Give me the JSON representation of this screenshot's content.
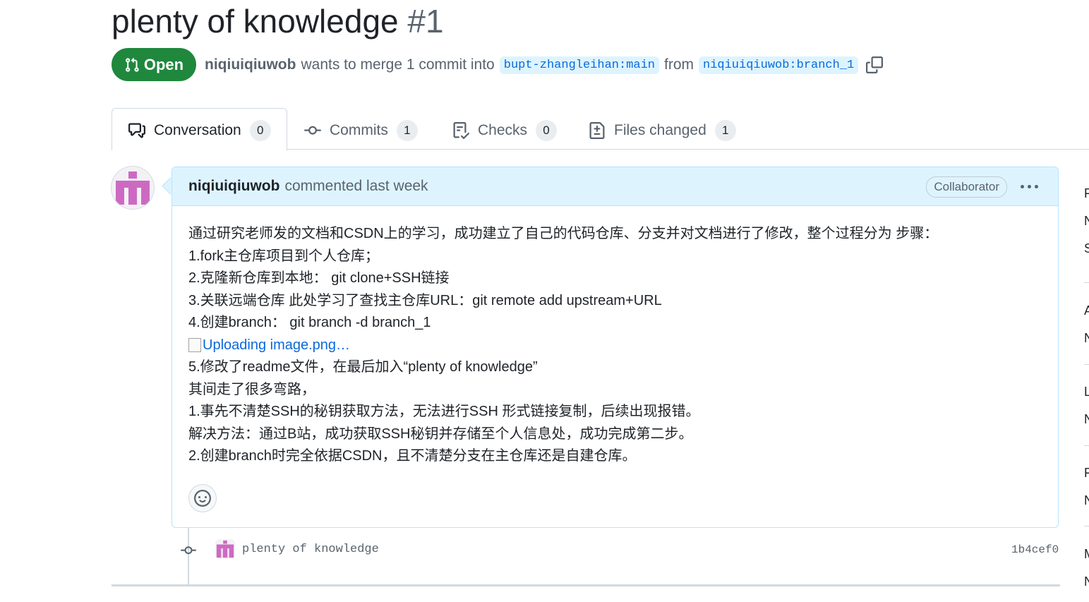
{
  "pr": {
    "title": "plenty of knowledge",
    "number": "#1",
    "state": "Open",
    "author": "niqiuiqiuwob",
    "merge_text": "wants to merge 1 commit into",
    "base_branch": "bupt-zhangleihan:main",
    "from_text": "from",
    "head_branch": "niqiuiqiuwob:branch_1"
  },
  "tabs": [
    {
      "label": "Conversation",
      "count": "0",
      "icon": "comment-discussion-icon"
    },
    {
      "label": "Commits",
      "count": "1",
      "icon": "commit-icon"
    },
    {
      "label": "Checks",
      "count": "0",
      "icon": "checklist-icon"
    },
    {
      "label": "Files changed",
      "count": "1",
      "icon": "file-diff-icon"
    }
  ],
  "comment": {
    "author": "niqiuiqiuwob",
    "meta": "commented last week",
    "badge": "Collaborator",
    "lines": [
      "通过研究老师发的文档和CSDN上的学习，成功建立了自己的代码仓库、分支并对文档进行了修改，整个过程分为 步骤：",
      "1.fork主仓库项目到个人仓库；",
      "2.克隆新仓库到本地： git clone+SSH链接",
      "3.关联远端仓库 此处学习了查找主仓库URL：git remote add upstream+URL",
      "4.创建branch： git branch -d branch_1",
      "Uploading image.png…",
      "5.修改了readme文件，在最后加入“plenty of knowledge”",
      "其间走了很多弯路，",
      "1.事先不清楚SSH的秘钥获取方法，无法进行SSH 形式链接复制，后续出现报错。",
      "解决方法：通过B站，成功获取SSH秘钥并存储至个人信息处，成功完成第二步。",
      "2.创建branch时完全依据CSDN，且不清楚分支在主仓库还是自建仓库。"
    ]
  },
  "commit": {
    "message": "plenty of knowledge",
    "sha": "1b4cef0"
  },
  "sidebar_letters": [
    "F",
    "N",
    "S",
    "A",
    "N",
    "L",
    "N",
    "F",
    "N",
    "M",
    "N"
  ],
  "colors": {
    "open_green": "#1f883d",
    "accent_blue": "#0969da",
    "comment_header_bg": "#ddf4ff",
    "avatar_pink": "#cc6ac2"
  }
}
